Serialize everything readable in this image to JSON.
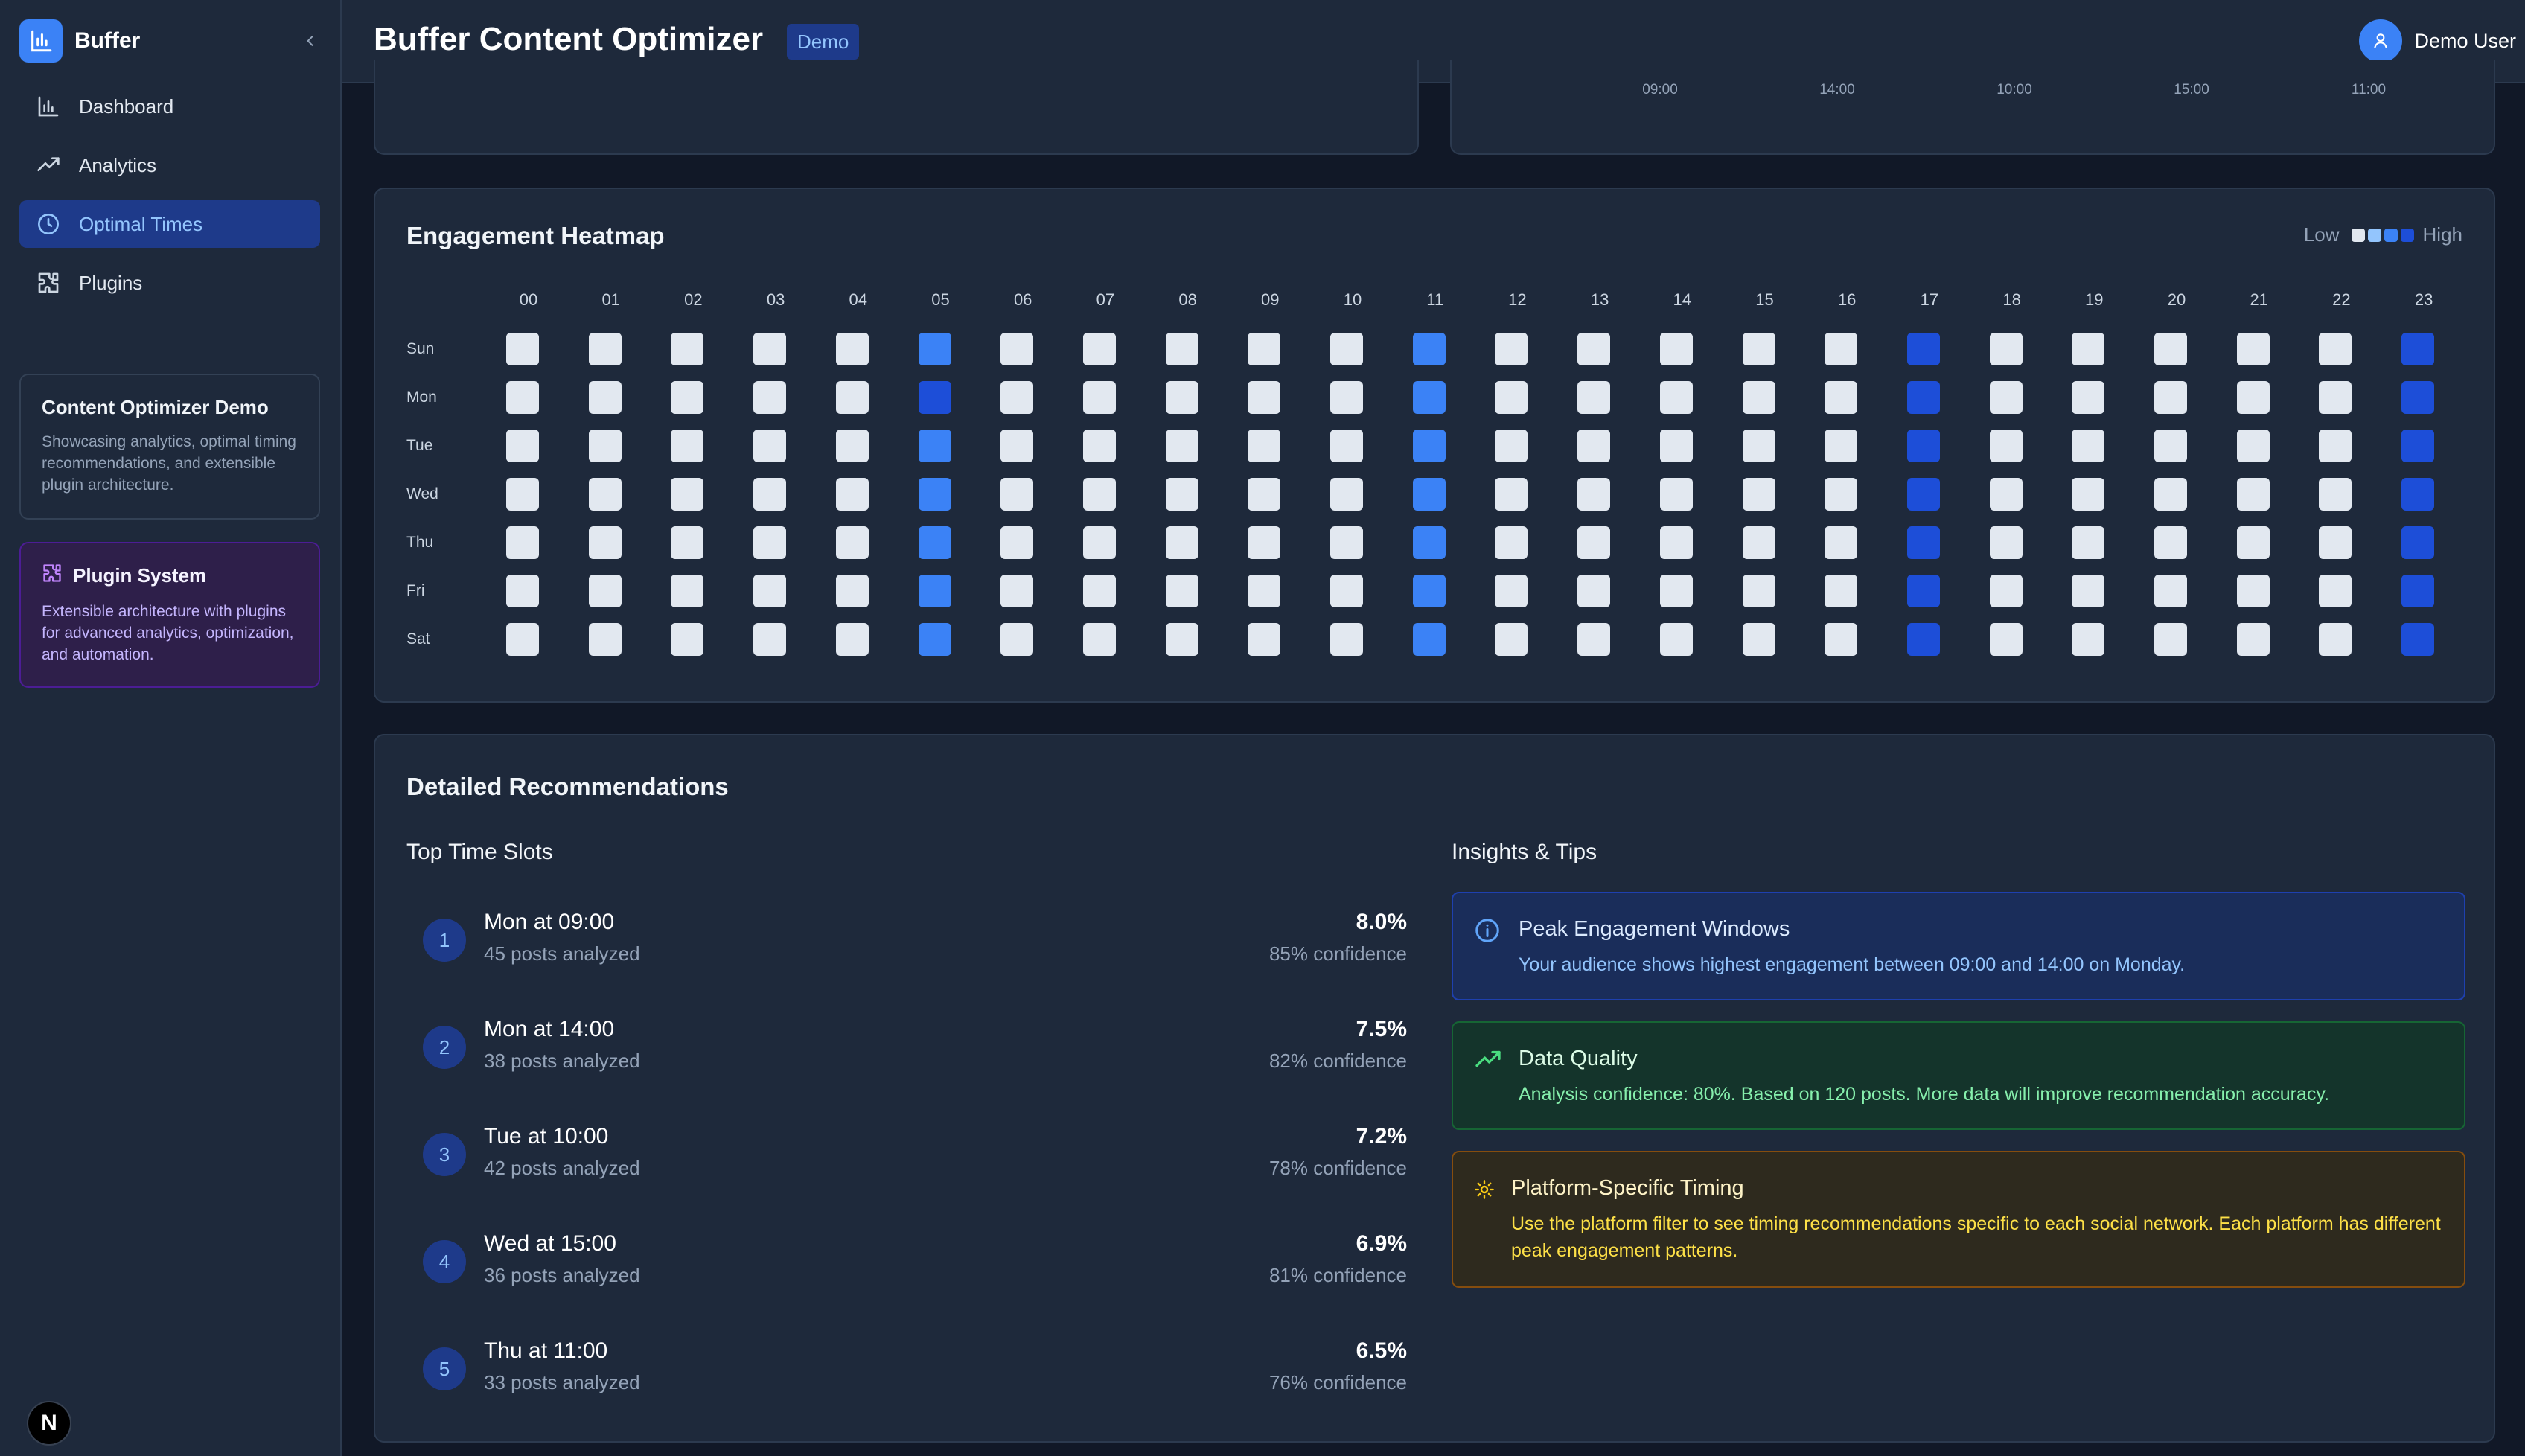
{
  "sidebar": {
    "brand": "Buffer",
    "nav": [
      {
        "label": "Dashboard",
        "icon": "bar-chart-icon",
        "active": false
      },
      {
        "label": "Analytics",
        "icon": "trending-up-icon",
        "active": false
      },
      {
        "label": "Optimal Times",
        "icon": "clock-icon",
        "active": true
      },
      {
        "label": "Plugins",
        "icon": "puzzle-icon",
        "active": false
      }
    ],
    "demo_card": {
      "title": "Content Optimizer Demo",
      "desc": "Showcasing analytics, optimal timing recommendations, and extensible plugin architecture."
    },
    "plugin_card": {
      "title": "Plugin System",
      "desc": "Extensible architecture with plugins for advanced analytics, optimization, and automation."
    },
    "badge": "N"
  },
  "header": {
    "title": "Buffer Content Optimizer",
    "badge": "Demo",
    "user": "Demo User"
  },
  "top_chart": {
    "x_ticks": [
      "09:00",
      "14:00",
      "10:00",
      "15:00",
      "11:00"
    ]
  },
  "heatmap": {
    "title": "Engagement Heatmap",
    "legend_low": "Low",
    "legend_high": "High",
    "legend_colors": [
      "#e2e8f0",
      "#93c5fd",
      "#3b82f6",
      "#1d4ed8"
    ],
    "hours": [
      "00",
      "01",
      "02",
      "03",
      "04",
      "05",
      "06",
      "07",
      "08",
      "09",
      "10",
      "11",
      "12",
      "13",
      "14",
      "15",
      "16",
      "17",
      "18",
      "19",
      "20",
      "21",
      "22",
      "23"
    ],
    "days": [
      "Sun",
      "Mon",
      "Tue",
      "Wed",
      "Thu",
      "Fri",
      "Sat"
    ],
    "levels": [
      [
        0,
        0,
        0,
        0,
        0,
        2,
        0,
        0,
        0,
        0,
        0,
        2,
        0,
        0,
        0,
        0,
        0,
        3,
        0,
        0,
        0,
        0,
        0,
        3
      ],
      [
        0,
        0,
        0,
        0,
        0,
        3,
        0,
        0,
        0,
        0,
        0,
        2,
        0,
        0,
        0,
        0,
        0,
        3,
        0,
        0,
        0,
        0,
        0,
        3
      ],
      [
        0,
        0,
        0,
        0,
        0,
        2,
        0,
        0,
        0,
        0,
        0,
        2,
        0,
        0,
        0,
        0,
        0,
        3,
        0,
        0,
        0,
        0,
        0,
        3
      ],
      [
        0,
        0,
        0,
        0,
        0,
        2,
        0,
        0,
        0,
        0,
        0,
        2,
        0,
        0,
        0,
        0,
        0,
        3,
        0,
        0,
        0,
        0,
        0,
        3
      ],
      [
        0,
        0,
        0,
        0,
        0,
        2,
        0,
        0,
        0,
        0,
        0,
        2,
        0,
        0,
        0,
        0,
        0,
        3,
        0,
        0,
        0,
        0,
        0,
        3
      ],
      [
        0,
        0,
        0,
        0,
        0,
        2,
        0,
        0,
        0,
        0,
        0,
        2,
        0,
        0,
        0,
        0,
        0,
        3,
        0,
        0,
        0,
        0,
        0,
        3
      ],
      [
        0,
        0,
        0,
        0,
        0,
        2,
        0,
        0,
        0,
        0,
        0,
        2,
        0,
        0,
        0,
        0,
        0,
        3,
        0,
        0,
        0,
        0,
        0,
        3
      ]
    ]
  },
  "recommendations": {
    "title": "Detailed Recommendations",
    "slots_title": "Top Time Slots",
    "slots": [
      {
        "rank": "1",
        "name": "Mon at 09:00",
        "posts": "45 posts analyzed",
        "rate": "8.0%",
        "confidence": "85% confidence"
      },
      {
        "rank": "2",
        "name": "Mon at 14:00",
        "posts": "38 posts analyzed",
        "rate": "7.5%",
        "confidence": "82% confidence"
      },
      {
        "rank": "3",
        "name": "Tue at 10:00",
        "posts": "42 posts analyzed",
        "rate": "7.2%",
        "confidence": "78% confidence"
      },
      {
        "rank": "4",
        "name": "Wed at 15:00",
        "posts": "36 posts analyzed",
        "rate": "6.9%",
        "confidence": "81% confidence"
      },
      {
        "rank": "5",
        "name": "Thu at 11:00",
        "posts": "33 posts analyzed",
        "rate": "6.5%",
        "confidence": "76% confidence"
      }
    ],
    "tips_title": "Insights & Tips",
    "tips": [
      {
        "title": "Peak Engagement Windows",
        "desc": "Your audience shows highest engagement between 09:00 and 14:00 on Monday.",
        "icon": "info-icon"
      },
      {
        "title": "Data Quality",
        "desc": "Analysis confidence: 80%. Based on 120 posts. More data will improve recommendation accuracy.",
        "icon": "trending-up-icon"
      },
      {
        "title": "Platform-Specific Timing",
        "desc": "Use the platform filter to see timing recommendations specific to each social network. Each platform has different peak engagement patterns.",
        "icon": "gear-icon"
      }
    ]
  }
}
